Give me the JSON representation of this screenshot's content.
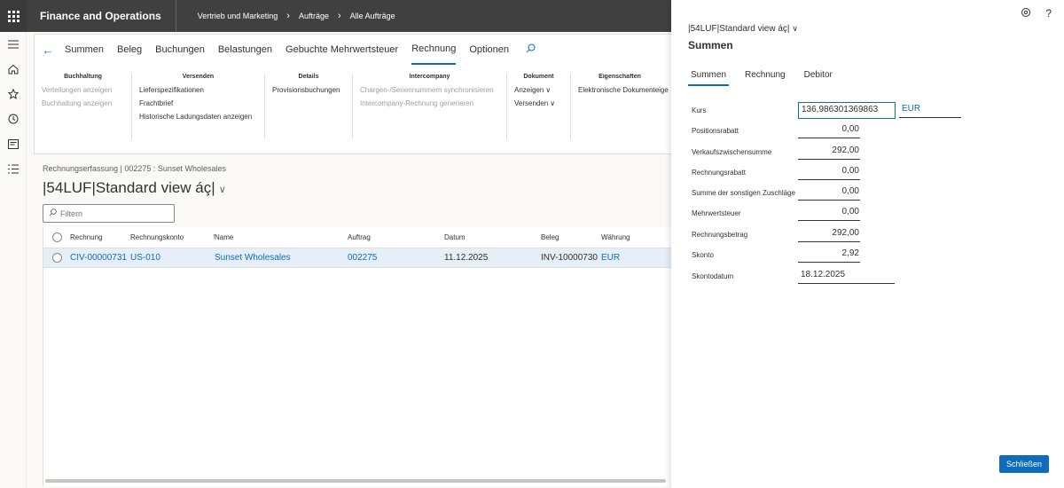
{
  "topbar": {
    "app_title": "Finance and Operations",
    "breadcrumb": [
      "Vertrieb und Marketing",
      "Aufträge",
      "Alle Aufträge"
    ]
  },
  "actionpane": {
    "tabs": [
      "Summen",
      "Beleg",
      "Buchungen",
      "Belastungen",
      "Gebuchte Mehrwertsteuer",
      "Rechnung",
      "Optionen"
    ],
    "active_tab": "Rechnung",
    "groups": {
      "buchhaltung": {
        "title": "Buchhaltung",
        "items": [
          "Verteilungen anzeigen",
          "Buchhaltung anzeigen"
        ]
      },
      "versenden": {
        "title": "Versenden",
        "items": [
          "Lieferspezifikationen",
          "Frachtbrief",
          "Historische Ladungsdaten anzeigen"
        ]
      },
      "details": {
        "title": "Details",
        "items": [
          "Provisionsbuchungen"
        ]
      },
      "intercompany": {
        "title": "Intercompany",
        "items": [
          "Chargen-/Seriennummern synchronisieren",
          "Intercompany-Rechnung generieren"
        ]
      },
      "dokument": {
        "title": "Dokument",
        "items": [
          "Anzeigen",
          "Versenden"
        ]
      },
      "eigenschaften": {
        "title": "Eigenschaften",
        "items": [
          "Elektronische Dokumenteige"
        ]
      }
    }
  },
  "page": {
    "breadcrumb": "Rechnungserfassung  |  002275 : Sunset Wholesales",
    "view_title": "|54LUF|Standard view áç|",
    "filter_placeholder": "Filtern"
  },
  "grid": {
    "columns": [
      "Rechnung",
      "Rechnungskonto",
      "Name",
      "Auftrag",
      "Datum",
      "Beleg",
      "Währung"
    ],
    "rows": [
      [
        "CIV-00000731",
        "US-010",
        "Sunset Wholesales",
        "002275",
        "11.12.2025",
        "INV-10000730",
        "EUR"
      ]
    ]
  },
  "panel": {
    "subtitle": "|54LUF|Standard view áç|",
    "title": "Summen",
    "tabs": [
      "Summen",
      "Rechnung",
      "Debitor"
    ],
    "fields": {
      "kurs": {
        "label": "Kurs",
        "value": "136,986301369863",
        "currency": "EUR"
      },
      "positionsrabatt": {
        "label": "Positionsrabatt",
        "value": "0,00"
      },
      "verkaufszwischensumme": {
        "label": "Verkaufszwischensumme",
        "value": "292,00"
      },
      "rechnungsrabatt": {
        "label": "Rechnungsrabatt",
        "value": "0,00"
      },
      "sonstige_zuschlaege": {
        "label": "Summe der sonstigen Zuschläge",
        "value": "0,00"
      },
      "mehrwertsteuer": {
        "label": "Mehrwertsteuer",
        "value": "0,00"
      },
      "rechnungsbetrag": {
        "label": "Rechnungsbetrag",
        "value": "292,00"
      },
      "skonto": {
        "label": "Skonto",
        "value": "2,92"
      },
      "skontodatum": {
        "label": "Skontodatum",
        "value": "18.12.2025"
      }
    },
    "close_label": "Schließen"
  },
  "icons": {
    "app_launcher": "waffle-icon",
    "menu": "hamburger-icon",
    "home": "home-icon",
    "favorites": "star-icon",
    "recent": "clock-icon",
    "workspaces": "workspace-icon",
    "modules": "list-icon",
    "settings": "settings-icon",
    "help": "help-icon"
  }
}
